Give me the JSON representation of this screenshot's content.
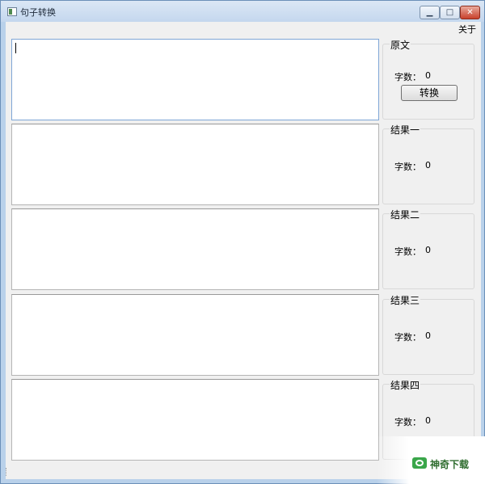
{
  "window": {
    "title": "句子转换",
    "min_glyph": "▁",
    "max_glyph": "□",
    "close_glyph": "✕"
  },
  "menu": {
    "about": "关于"
  },
  "original": {
    "title": "原文",
    "count_label": "字数：",
    "count": "0",
    "convert_label": "转换"
  },
  "results": [
    {
      "title": "结果一",
      "count_label": "字数：",
      "count": "0"
    },
    {
      "title": "结果二",
      "count_label": "字数：",
      "count": "0"
    },
    {
      "title": "结果三",
      "count_label": "字数：",
      "count": "0"
    },
    {
      "title": "结果四",
      "count_label": "字数：",
      "count": "0"
    }
  ],
  "watermark": {
    "text": "神奇下载"
  }
}
